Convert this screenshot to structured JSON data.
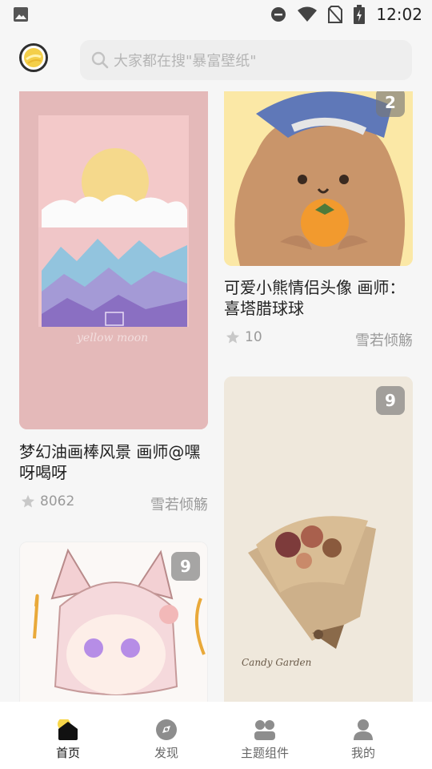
{
  "status_bar": {
    "time": "12:02"
  },
  "search": {
    "placeholder": "大家都在搜\"暴富壁纸\""
  },
  "cards": [
    {
      "title_line1": "梦幻油画棒风景  画师@嘿",
      "title_line2": "呀喝呀",
      "likes": "8062",
      "author": "雪若倾觞",
      "badge": ""
    },
    {
      "title_line1": "可爱小熊情侣头像  画师：",
      "title_line2": "喜塔腊球球",
      "likes": "10",
      "author": "雪若倾觞",
      "badge": "2"
    },
    {
      "title_line1": "",
      "title_line2": "",
      "likes": "",
      "author": "",
      "badge": "9"
    },
    {
      "title_line1": "",
      "title_line2": "",
      "likes": "",
      "author": "",
      "badge": "9"
    }
  ],
  "card_image_text": {
    "yellow_moon": "yellow moon",
    "candy_garden": "Candy Garden"
  },
  "nav": [
    {
      "label": "首页",
      "icon": "home-icon",
      "active": true
    },
    {
      "label": "发现",
      "icon": "discover-icon",
      "active": false
    },
    {
      "label": "主题组件",
      "icon": "widgets-icon",
      "active": false
    },
    {
      "label": "我的",
      "icon": "profile-icon",
      "active": false
    }
  ],
  "colors": {
    "accent_yellow": "#f7d64a",
    "card_pink": "#e2b8b8",
    "bear_bg": "#fbe9a8",
    "text_dark": "#222222",
    "text_muted": "#9a9a9a"
  }
}
